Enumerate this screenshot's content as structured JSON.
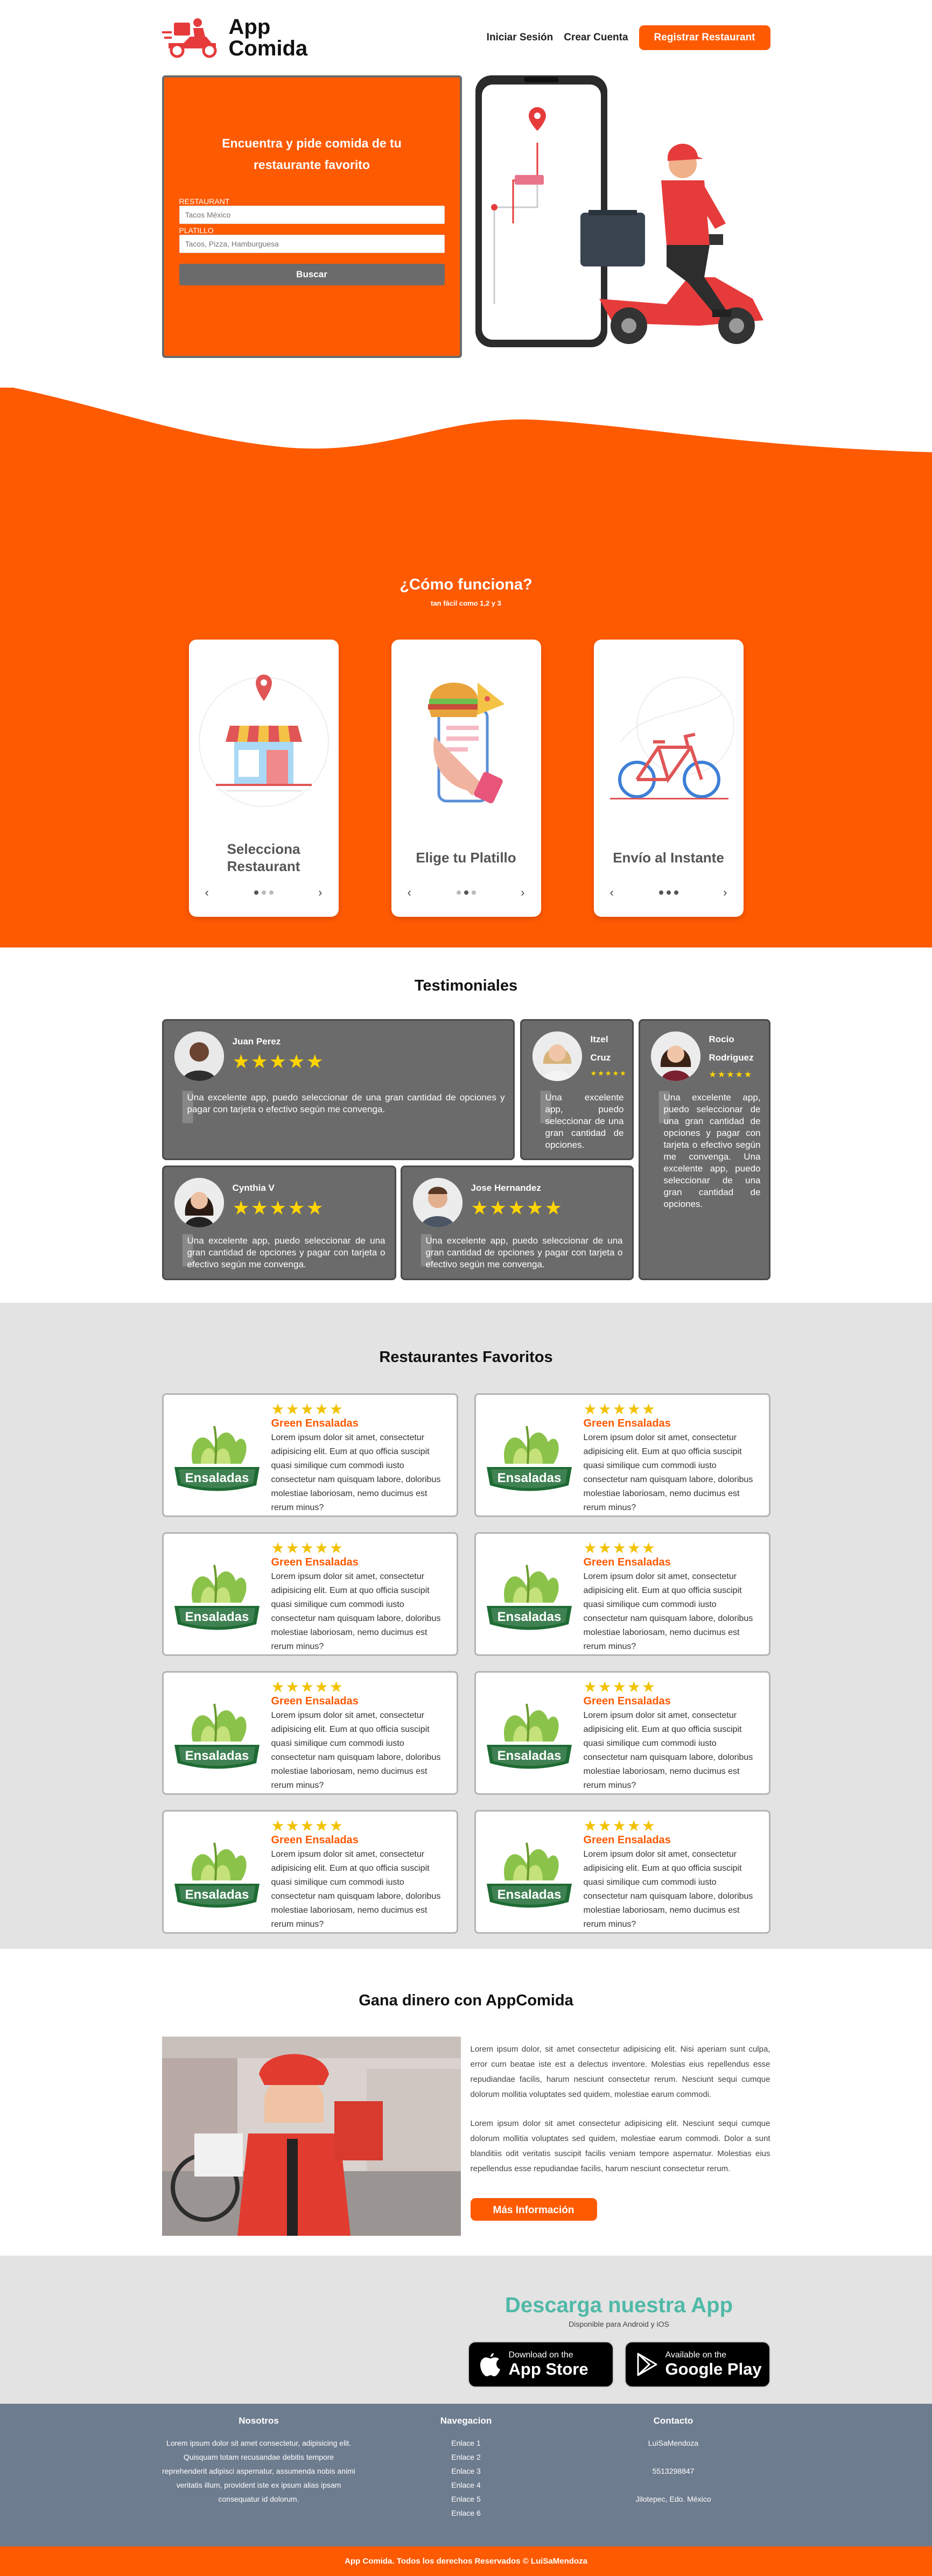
{
  "header": {
    "brand": "App Comida",
    "nav": {
      "login": "Iniciar Sesión",
      "create": "Crear Cuenta",
      "register_restaurant": "Registrar Restaurant"
    }
  },
  "hero": {
    "title": "Encuentra y pide comida de tu restaurante favorito",
    "restaurant_label": "RESTAURANT",
    "restaurant_placeholder": "Tacos México",
    "dish_label": "PLATILLO",
    "dish_placeholder": "Tacos, Pizza, Hamburguesa",
    "search_button": "Buscar"
  },
  "how": {
    "title": "¿Cómo funciona?",
    "subtitle": "tan fácil como 1,2 y 3",
    "steps": [
      {
        "title": "Selecciona Restaurant"
      },
      {
        "title": "Elige tu Platillo"
      },
      {
        "title": "Envío al Instante"
      }
    ],
    "prev": "‹",
    "next": "›"
  },
  "testimonials": {
    "title": "Testimoniales",
    "star_glyph": "★★★★★",
    "items": [
      {
        "name": "Juan Perez",
        "quote": "Una excelente app, puedo seleccionar de una gran cantidad de opciones y pagar con tarjeta o efectivo según me convenga."
      },
      {
        "name": "Itzel Cruz",
        "quote": "Una excelente app, puedo seleccionar de una gran cantidad de opciones."
      },
      {
        "name": "Rocio Rodriguez",
        "quote": "Una excelente app, puedo seleccionar de una gran cantidad de opciones y pagar con tarjeta o efectivo según me convenga. Una excelente app, puedo seleccionar de una gran cantidad de opciones."
      },
      {
        "name": "Cynthia V",
        "quote": "Una excelente app, puedo seleccionar de una gran cantidad de opciones y pagar con tarjeta o efectivo según me convenga."
      },
      {
        "name": "Jose Hernandez",
        "quote": "Una excelente app, puedo seleccionar de una gran cantidad de opciones y pagar con tarjeta o efectivo según me convenga."
      }
    ]
  },
  "favorites": {
    "title": "Restaurantes Favoritos",
    "star_glyph": "★★★★★",
    "logo_text": "Ensaladas",
    "name": "Green Ensaladas",
    "description": "Lorem ipsum dolor sit amet, consectetur adipisicing elit. Eum at quo officia suscipit quasi similique cum commodi iusto consectetur nam quisquam labore, doloribus molestiae laboriosam, nemo ducimus est rerum minus?"
  },
  "earn": {
    "title": "Gana dinero con AppComida",
    "p1": "Lorem ipsum dolor, sit amet consectetur adipisicing elit. Nisi aperiam sunt culpa, error cum beatae iste est a delectus inventore. Molestias eius repellendus esse repudiandae facilis, harum nesciunt consectetur rerum. Nesciunt sequi cumque dolorum mollitia voluptates sed quidem, molestiae earum commodi.",
    "p2": "Lorem ipsum dolor sit amet consectetur adipisicing elit. Nesciunt sequi cumque dolorum mollitia voluptates sed quidem, molestiae earum commodi. Dolor a sunt blanditiis odit veritatis suscipit facilis veniam tempore aspernatur. Molestias eius repellendus esse repudiandae facilis, harum nesciunt consectetur rerum.",
    "button": "Más Información"
  },
  "download": {
    "title": "Descarga nuestra App",
    "subtitle": "Disponible para Android y iOS",
    "apple_small": "Download on the",
    "apple_big": "App Store",
    "google_small": "Available on the",
    "google_big": "Google Play"
  },
  "footer": {
    "col1_title": "Nosotros",
    "col1_body": "Lorem ipsum dolor sit amet consectetur, adipisicing elit. Quisquam totam recusandae debitis tempore reprehenderit adipisci aspernatur, assumenda nobis animi veritatis illum, provident iste ex ipsum alias ipsam consequatur id dolorum.",
    "col2_title": "Navegacion",
    "links": [
      "Enlace 1",
      "Enlace 2",
      "Enlace 3",
      "Enlace 4",
      "Enlace 5",
      "Enlace 6"
    ],
    "col3_title": "Contacto",
    "contact_name": "LuiSaMendoza",
    "contact_phone": "5513298847",
    "contact_place": "Jilotepec, Edo. México",
    "copyright": "App Comida. Todos los derechos Reservados © LuiSaMendoza"
  },
  "colors": {
    "brand": "#fe5a02",
    "gray_card": "#6b6b6b",
    "teal": "#50b9a8",
    "footer": "#6e7c8f",
    "stars": "#f2c200"
  }
}
